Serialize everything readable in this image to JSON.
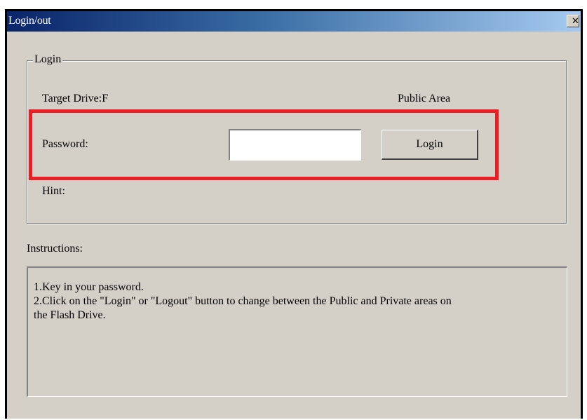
{
  "window": {
    "title": "Login/out",
    "close_glyph": "✕",
    "close_icon": "close-icon"
  },
  "login_group": {
    "legend": "Login",
    "target_drive": "Target Drive:F",
    "area": "Public Area",
    "password_label": "Password:",
    "password_value": "",
    "login_button": "Login",
    "hint_label": "Hint:"
  },
  "instructions": {
    "heading": "Instructions:",
    "lines": [
      "1.Key in your password.",
      "2.Click on the \"Login\" or \"Logout\" button to change between the Public and Private areas on",
      "the Flash Drive."
    ]
  },
  "colors": {
    "title_gradient_start": "#0a246a",
    "title_gradient_end": "#a6caf0",
    "dialog_face": "#d4d0c8",
    "highlight": "#ee1c24"
  }
}
